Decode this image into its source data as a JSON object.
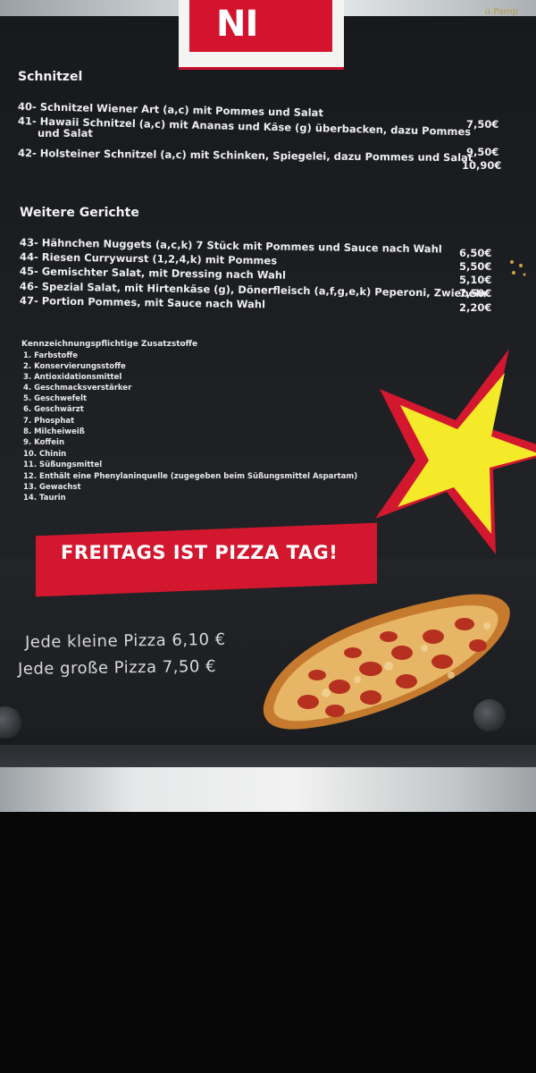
{
  "logo": {
    "text": "NI"
  },
  "top_right_text": "ü Pamp",
  "schnitzel": {
    "heading": "Schnitzel",
    "items": [
      {
        "text": "40- Schnitzel Wiener Art (a,c) mit Pommes und Salat",
        "price": ""
      },
      {
        "text": "41- Hawaii Schnitzel (a,c) mit Ananas und Käse (g) überbacken, dazu Pommes",
        "price": "7,50€"
      },
      {
        "text": "und Salat",
        "price": ""
      },
      {
        "text": "42- Holsteiner Schnitzel (a,c) mit Schinken, Spiegelei, dazu Pommes und Salat",
        "price": "9,50€"
      },
      {
        "text": "",
        "price": "10,90€"
      }
    ]
  },
  "weitere": {
    "heading": "Weitere Gerichte",
    "items": [
      {
        "text": "43- Hähnchen Nuggets (a,c,k) 7 Stück mit Pommes und Sauce nach Wahl",
        "price": "6,50€"
      },
      {
        "text": "44- Riesen Currywurst (1,2,4,k) mit Pommes",
        "price": "5,50€"
      },
      {
        "text": "45- Gemischter Salat, mit Dressing nach Wahl",
        "price": "5,10€"
      },
      {
        "text": "46- Spezial Salat, mit Hirtenkäse (g), Dönerfleisch (a,f,g,e,k) Peperoni, Zwiebeln",
        "price": "7,50€"
      },
      {
        "text": "47- Portion Pommes, mit Sauce nach Wahl",
        "price": "2,20€"
      }
    ]
  },
  "additives": {
    "heading": "Kennzeichnungspflichtige Zusatzstoffe",
    "items": [
      "1.  Farbstoffe",
      "2.  Konservierungsstoffe",
      "3.  Antioxidationsmittel",
      "4.  Geschmacksverstärker",
      "5.  Geschwefelt",
      "6.  Geschwärzt",
      "7.  Phosphat",
      "8.  Milcheiweiß",
      "9.  Koffein",
      "10. Chinin",
      "11. Süßungsmittel",
      "12. Enthält eine Phenylaninquelle (zugegeben beim Süßungsmittel Aspartam)",
      "13. Gewachst",
      "14. Taurin"
    ]
  },
  "banner": {
    "text": "FREITAGS IST PIZZA TAG!"
  },
  "offers": {
    "small": "Jede kleine Pizza 6,10 €",
    "large": "Jede große Pizza 7,50 €"
  },
  "colors": {
    "banner_red": "#d3172f",
    "star_yellow": "#f4ea2a",
    "star_red": "#d3172f",
    "board": "#1c1e22"
  }
}
